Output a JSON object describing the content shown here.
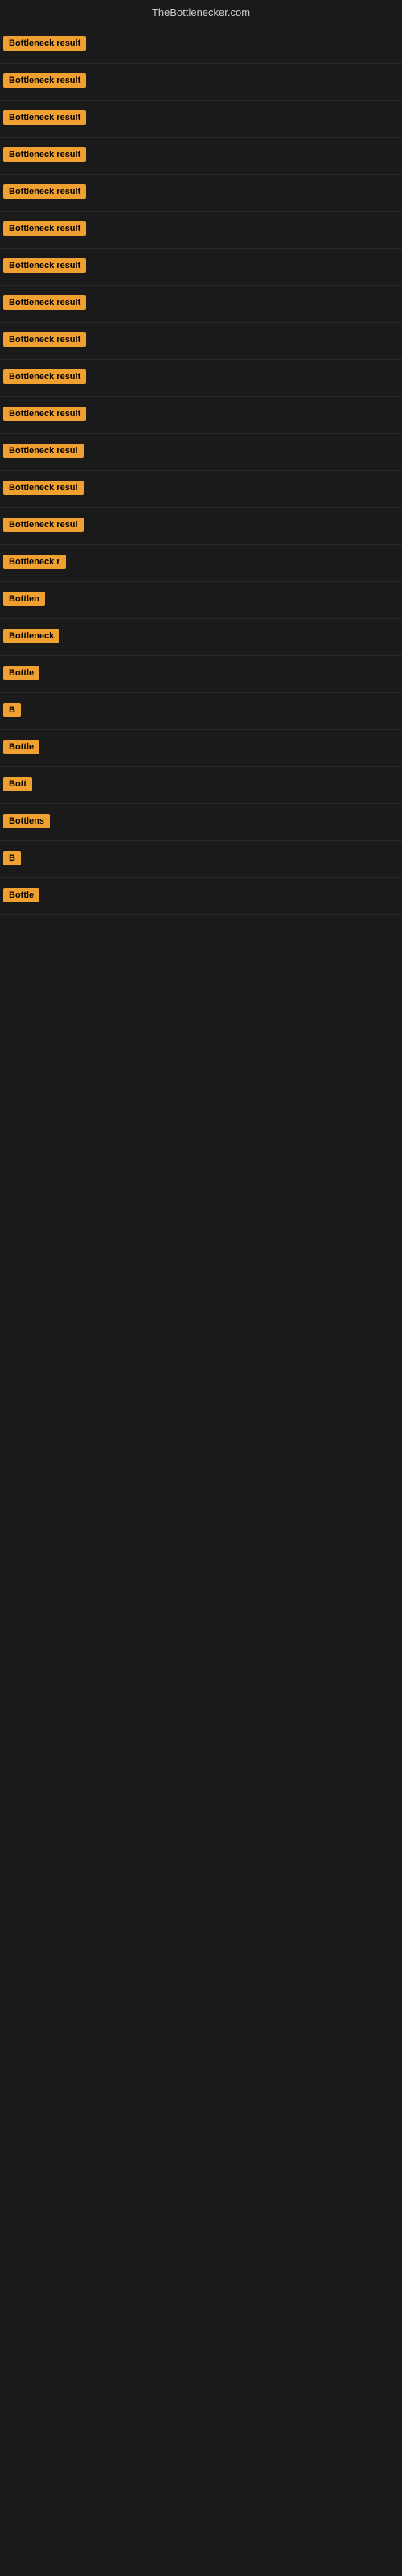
{
  "site": {
    "title": "TheBottlenecker.com"
  },
  "badges": [
    {
      "label": "Bottleneck result",
      "width": "full"
    },
    {
      "label": "Bottleneck result",
      "width": "full"
    },
    {
      "label": "Bottleneck result",
      "width": "full"
    },
    {
      "label": "Bottleneck result",
      "width": "full"
    },
    {
      "label": "Bottleneck result",
      "width": "full"
    },
    {
      "label": "Bottleneck result",
      "width": "full"
    },
    {
      "label": "Bottleneck result",
      "width": "full"
    },
    {
      "label": "Bottleneck result",
      "width": "full"
    },
    {
      "label": "Bottleneck result",
      "width": "full"
    },
    {
      "label": "Bottleneck result",
      "width": "full"
    },
    {
      "label": "Bottleneck result",
      "width": "full"
    },
    {
      "label": "Bottleneck resul",
      "width": "partial"
    },
    {
      "label": "Bottleneck resul",
      "width": "partial"
    },
    {
      "label": "Bottleneck resul",
      "width": "partial"
    },
    {
      "label": "Bottleneck r",
      "width": "partial"
    },
    {
      "label": "Bottlen",
      "width": "partial"
    },
    {
      "label": "Bottleneck",
      "width": "partial"
    },
    {
      "label": "Bottle",
      "width": "partial"
    },
    {
      "label": "B",
      "width": "partial"
    },
    {
      "label": "Bottle",
      "width": "partial"
    },
    {
      "label": "Bott",
      "width": "partial"
    },
    {
      "label": "Bottlens",
      "width": "partial"
    },
    {
      "label": "B",
      "width": "partial"
    },
    {
      "label": "Bottle",
      "width": "partial"
    }
  ]
}
